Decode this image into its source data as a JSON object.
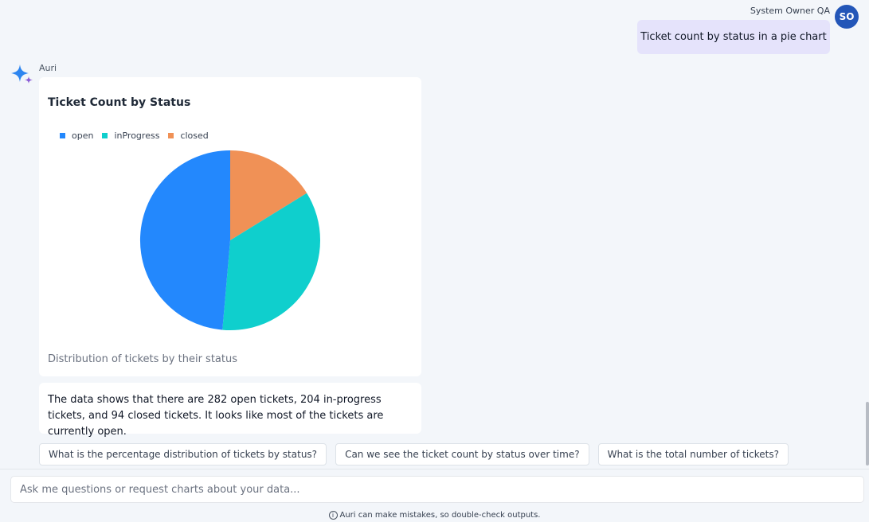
{
  "user": {
    "name": "System Owner QA",
    "initials": "SO"
  },
  "messages": {
    "user_prompt": "Ticket count by status in a pie chart",
    "assistant_name": "Auri",
    "answer": "The data shows that there are 282 open tickets, 204 in-progress tickets, and 94 closed tickets. It looks like most of the tickets are currently open."
  },
  "chart_data": {
    "type": "pie",
    "title": "Ticket Count by Status",
    "caption": "Distribution of tickets by their status",
    "legend_position": "top-left",
    "categories": [
      "open",
      "inProgress",
      "closed"
    ],
    "values": [
      282,
      204,
      94
    ],
    "colors": [
      "#2388fd",
      "#0fcfcd",
      "#f09156"
    ]
  },
  "suggestions": [
    "What is the percentage distribution of tickets by status?",
    "Can we see the ticket count by status over time?",
    "What is the total number of tickets?"
  ],
  "input": {
    "placeholder": "Ask me questions or request charts about your data..."
  },
  "footer": {
    "disclaimer": "Auri can make mistakes, so double-check outputs."
  },
  "icons": {
    "assistant": "sparkle-icon",
    "disclaimer": "info-icon"
  },
  "colors": {
    "avatar": "#2356b8",
    "user_bubble": "#e5e3fb",
    "sparkle_primary": "#2e86f0",
    "sparkle_secondary": "#8a5cd6"
  }
}
